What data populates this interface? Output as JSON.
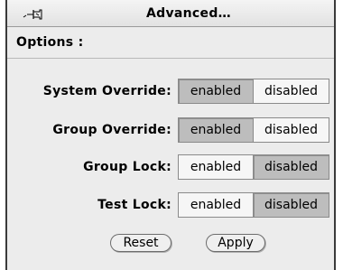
{
  "window": {
    "title": "Advanced…"
  },
  "options": {
    "label": "Options :"
  },
  "rows": [
    {
      "label": "System Override:",
      "enabled_label": "enabled",
      "disabled_label": "disabled",
      "selected": "enabled"
    },
    {
      "label": "Group Override:",
      "enabled_label": "enabled",
      "disabled_label": "disabled",
      "selected": "enabled"
    },
    {
      "label": "Group Lock:",
      "enabled_label": "enabled",
      "disabled_label": "disabled",
      "selected": "disabled"
    },
    {
      "label": "Test Lock:",
      "enabled_label": "enabled",
      "disabled_label": "disabled",
      "selected": "disabled"
    }
  ],
  "actions": {
    "reset_label": "Reset",
    "apply_label": "Apply"
  },
  "icons": {
    "pin": "pushpin-icon"
  },
  "colors": {
    "selected_bg": "#bdbdbd",
    "unselected_bg": "#f6f6f6",
    "window_bg": "#ececec"
  }
}
